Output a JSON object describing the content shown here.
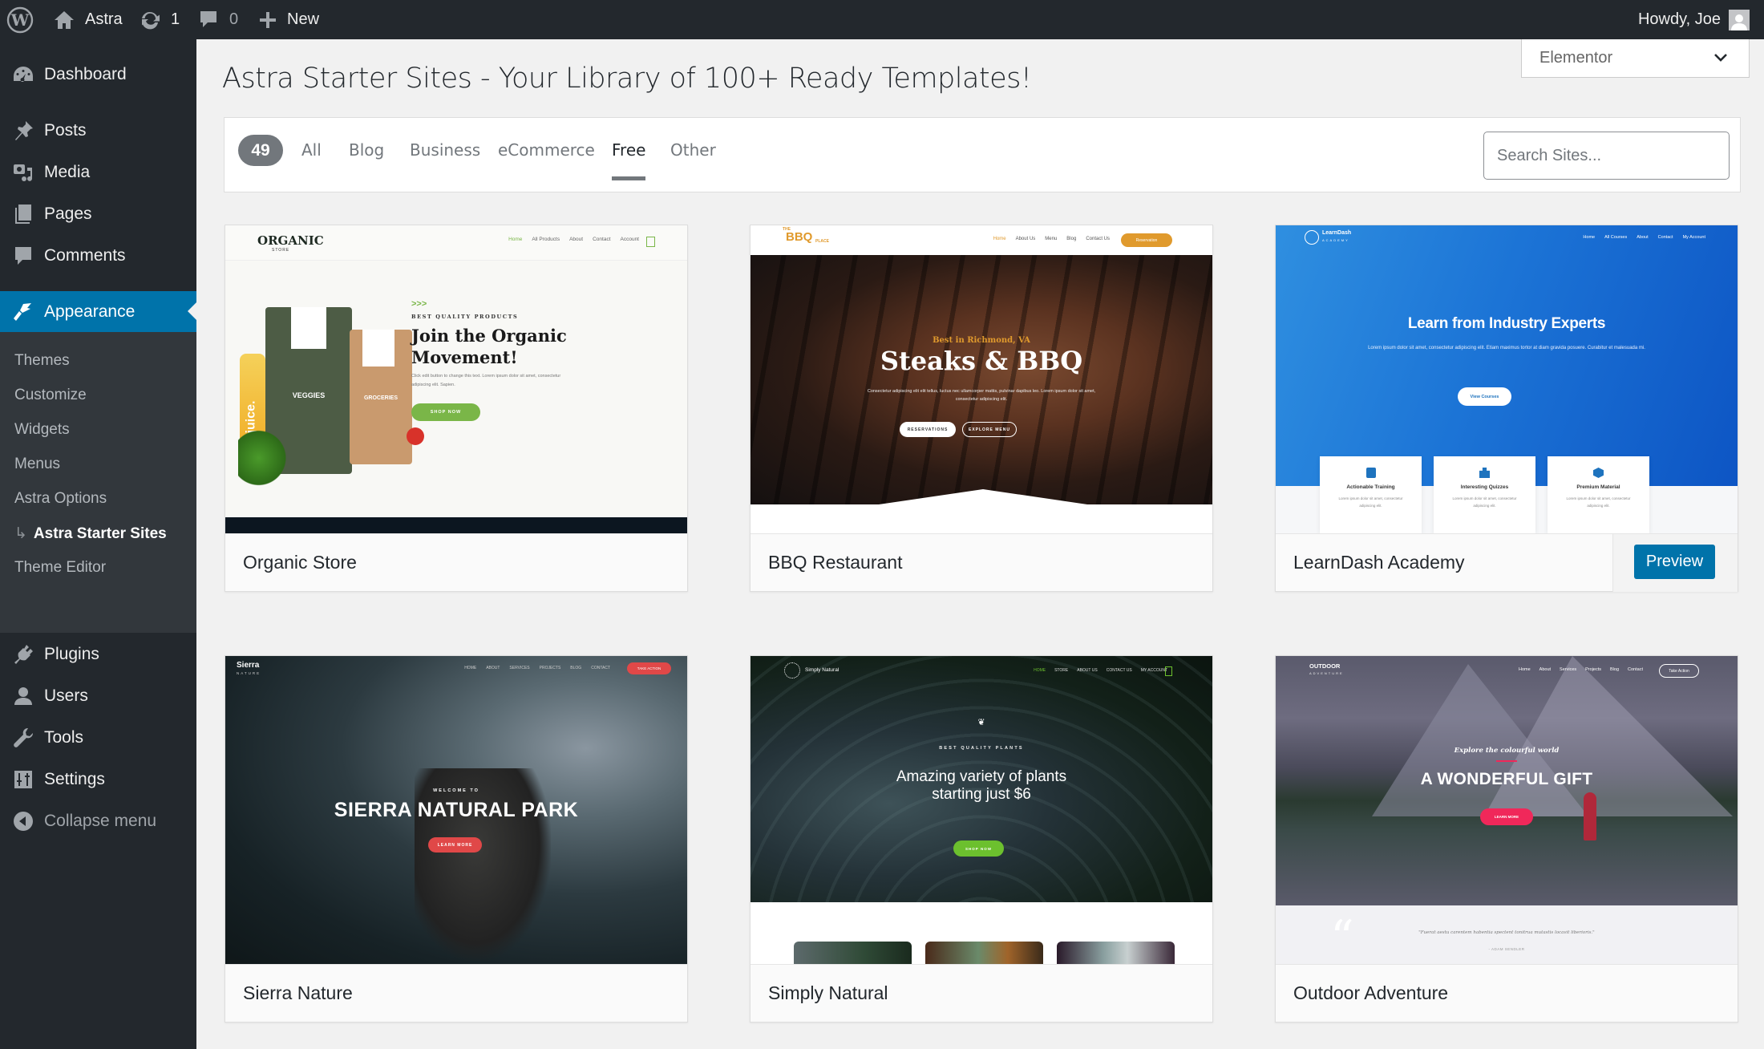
{
  "admin_bar": {
    "wp_logo_icon": "wordpress-logo-icon",
    "site_name": "Astra",
    "updates_count": "1",
    "comments_count": "0",
    "new_label": "New",
    "greeting": "Howdy, Joe"
  },
  "sidebar": {
    "items": [
      {
        "label": "Dashboard",
        "icon": "dashboard-icon"
      },
      {
        "label": "Posts",
        "icon": "pin-icon"
      },
      {
        "label": "Media",
        "icon": "media-icon"
      },
      {
        "label": "Pages",
        "icon": "pages-icon"
      },
      {
        "label": "Comments",
        "icon": "comment-icon"
      },
      {
        "label": "Appearance",
        "icon": "paintbrush-icon",
        "active": true
      },
      {
        "label": "Plugins",
        "icon": "plugin-icon"
      },
      {
        "label": "Users",
        "icon": "user-icon"
      },
      {
        "label": "Tools",
        "icon": "wrench-icon"
      },
      {
        "label": "Settings",
        "icon": "sliders-icon"
      }
    ],
    "submenu": [
      {
        "label": "Themes"
      },
      {
        "label": "Customize"
      },
      {
        "label": "Widgets"
      },
      {
        "label": "Menus"
      },
      {
        "label": "Astra Options"
      },
      {
        "label": "Astra Starter Sites",
        "current": true,
        "prefix": "↳"
      },
      {
        "label": "Theme Editor"
      }
    ],
    "collapse_label": "Collapse menu"
  },
  "main": {
    "title": "Astra Starter Sites - Your Library of 100+ Ready Templates!",
    "page_builder": {
      "selected": "Elementor"
    },
    "filters": {
      "count": "49",
      "tabs": [
        {
          "label": "All"
        },
        {
          "label": "Blog"
        },
        {
          "label": "Business"
        },
        {
          "label": "eCommerce"
        },
        {
          "label": "Free",
          "active": true
        },
        {
          "label": "Other"
        }
      ],
      "search_placeholder": "Search Sites..."
    },
    "sites": [
      {
        "name": "Organic Store",
        "thumb": {
          "logo": "ORGANIC",
          "logo_sub": "STORE",
          "nav": [
            "Home",
            "All Products",
            "About",
            "Contact",
            "Account"
          ],
          "eyebrow": "BEST QUALITY PRODUCTS",
          "headline": "Join the Organic Movement!",
          "body": "Click edit button to change this text. Lorem ipsum dolor sit amet, consectetur adipiscing elit. Sapien.",
          "cta": "SHOP NOW",
          "pouch_left": "VEGGIES",
          "pouch_right": "GROCERIES",
          "bottle": "juice.",
          "accent": "#7ab648"
        }
      },
      {
        "name": "BBQ Restaurant",
        "thumb": {
          "logo": "BBQ",
          "logo_pre": "THE",
          "logo_sub": "PLACE",
          "nav": [
            "Home",
            "About Us",
            "Menu",
            "Blog",
            "Contact Us"
          ],
          "nav_cta": "Reservation",
          "eyebrow": "Best in Richmond, VA",
          "headline": "Steaks & BBQ",
          "body": "Consectetur adipiscing elit elit tellus, luctus nec ullamcorper mattis, pulvinar dapibus leo. Lorem ipsum dolor sit amet, consectetur adipiscing elit.",
          "cta_primary": "RESERVATIONS",
          "cta_secondary": "EXPLORE MENU",
          "accent": "#e09a2d"
        }
      },
      {
        "name": "LearnDash Academy",
        "preview_label": "Preview",
        "thumb": {
          "logo": "LearnDash",
          "logo_sub": "ACADEMY",
          "nav": [
            "Home",
            "All Courses",
            "About",
            "Contact",
            "My Account"
          ],
          "headline": "Learn from Industry Experts",
          "body": "Lorem ipsum dolor sit amet, consectetur adipiscing elit. Etiam maximus tortor at diam gravida posuere. Curabitur et malesuada mi.",
          "cta": "View Courses",
          "features": [
            {
              "title": "Actionable Training",
              "text": "Lorem ipsum dolor sit amet, consectetur adipiscing elit."
            },
            {
              "title": "Interesting Quizzes",
              "text": "Lorem ipsum dolor sit amet, consectetur adipiscing elit."
            },
            {
              "title": "Premium Material",
              "text": "Lorem ipsum dolor sit amet, consectetur adipiscing elit."
            }
          ],
          "accent": "#1e73be"
        }
      },
      {
        "name": "Sierra Nature",
        "thumb": {
          "logo": "Sierra",
          "logo_sub": "NATURE",
          "nav": [
            "HOME",
            "ABOUT",
            "SERVICES",
            "PROJECTS",
            "BLOG",
            "CONTACT"
          ],
          "nav_cta": "TAKE ACTION",
          "eyebrow": "WELCOME TO",
          "headline": "SIERRA NATURAL PARK",
          "cta": "LEARN MORE",
          "accent": "#e04848"
        }
      },
      {
        "name": "Simply Natural",
        "thumb": {
          "logo": "Simply Natural",
          "nav": [
            "HOME",
            "STORE",
            "ABOUT US",
            "CONTACT US",
            "MY ACCOUNT"
          ],
          "eyebrow": "BEST QUALITY PLANTS",
          "headline": "Amazing variety of plants starting just $6",
          "cta": "SHOP NOW",
          "accent": "#6cc02e"
        }
      },
      {
        "name": "Outdoor Adventure",
        "thumb": {
          "logo": "OUTDOOR",
          "logo_sub": "ADVENTURE",
          "nav": [
            "Home",
            "About",
            "Services",
            "Projects",
            "Blog",
            "Contact"
          ],
          "nav_cta": "Take Action",
          "eyebrow": "Explore the colourful world",
          "headline": "A WONDERFUL GIFT",
          "cta": "LEARN MORE",
          "quote": "\"Fuerat aestu carentem habentia spectent tonitrua mutastis locavit liberioris.\"",
          "quote_author": "- ADAM SENDLER",
          "accent": "#f0285a"
        }
      }
    ]
  }
}
